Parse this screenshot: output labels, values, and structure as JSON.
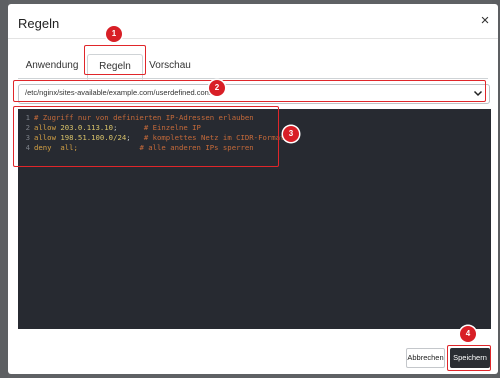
{
  "dialog": {
    "title": "Regeln",
    "close_glyph": "×"
  },
  "tabs": [
    {
      "label": "Anwendung",
      "active": false
    },
    {
      "label": "Regeln",
      "active": true
    },
    {
      "label": "Vorschau",
      "active": false
    }
  ],
  "file_select": {
    "value": "/etc/nginx/sites-available/example.com/userdefined.conf.init",
    "icon": "chevron-down-icon"
  },
  "editor": {
    "line_numbers": [
      "1",
      "2",
      "3",
      "4"
    ],
    "lines": [
      [
        {
          "text": "# Zugriff nur von definierten IP-Adressen erlauben",
          "kind": "comment"
        }
      ],
      [
        {
          "text": "allow ",
          "kind": "kw"
        },
        {
          "text": "203.0.113.10",
          "kind": "num"
        },
        {
          "text": ";      ",
          "kind": "plain"
        },
        {
          "text": "# Einzelne IP",
          "kind": "comment"
        }
      ],
      [
        {
          "text": "allow ",
          "kind": "kw"
        },
        {
          "text": "198.51.100.0/24",
          "kind": "num"
        },
        {
          "text": ";   ",
          "kind": "plain"
        },
        {
          "text": "# komplettes Netz im CIDR-Format",
          "kind": "comment"
        }
      ],
      [
        {
          "text": "deny  all;              ",
          "kind": "kw"
        },
        {
          "text": "# alle anderen IPs sperren",
          "kind": "comment"
        }
      ]
    ]
  },
  "footer": {
    "cancel_label": "Abbrechen",
    "save_label": "Speichern"
  },
  "annotations": [
    "1",
    "2",
    "3",
    "4"
  ],
  "colors": {
    "highlight": "#e0262a",
    "badge": "#d81f26",
    "editor_bg": "#272a31",
    "save_bg": "#2a2d33"
  }
}
